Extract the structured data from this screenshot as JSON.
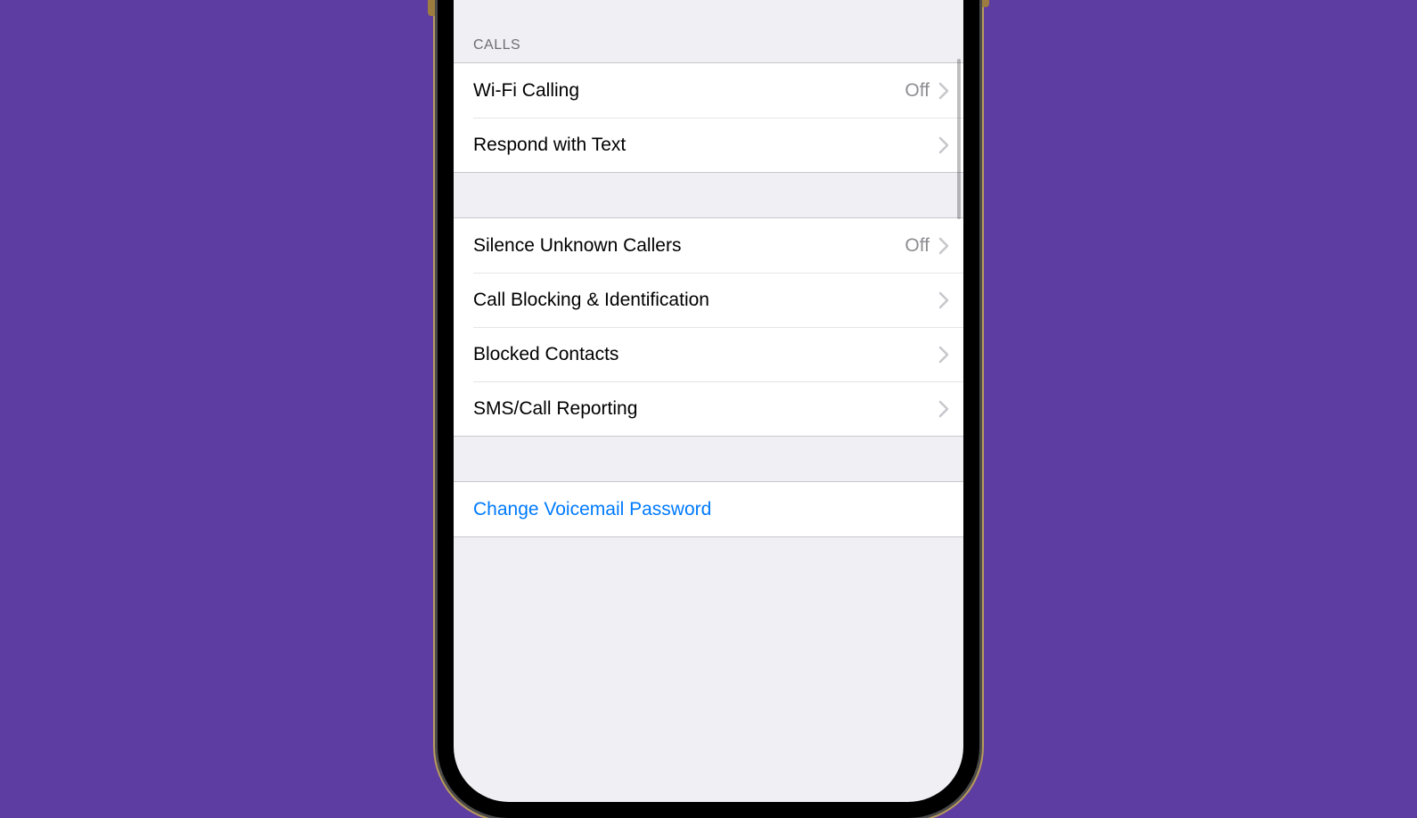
{
  "section_header": "CALLS",
  "groups": {
    "calls": [
      {
        "label": "Wi-Fi Calling",
        "value": "Off"
      },
      {
        "label": "Respond with Text",
        "value": ""
      }
    ],
    "blocking": [
      {
        "label": "Silence Unknown Callers",
        "value": "Off"
      },
      {
        "label": "Call Blocking & Identification",
        "value": ""
      },
      {
        "label": "Blocked Contacts",
        "value": ""
      },
      {
        "label": "SMS/Call Reporting",
        "value": ""
      }
    ],
    "voicemail": [
      {
        "label": "Change Voicemail Password",
        "value": "",
        "link": true
      }
    ]
  }
}
